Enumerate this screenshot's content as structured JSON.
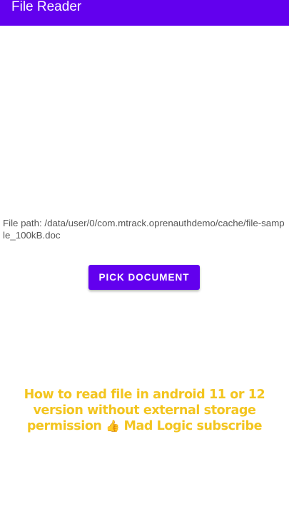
{
  "app_bar": {
    "title": "File Reader",
    "color": "#6200ee"
  },
  "main": {
    "file_path_text": "File path: /data/user/0/com.mtrack.oprenauthdemo/cache/file-sample_100kB.doc",
    "pick_button_label": "PICK DOCUMENT",
    "accent_color": "#6200ee"
  },
  "overlay_caption": {
    "line1": "How to read file in android 11 or 12",
    "line2": "version without external storage",
    "line3_before_icon": "permission",
    "icon": "thumbs-up-icon",
    "icon_glyph": "👍",
    "line3_after_icon": "Mad Logic subscribe",
    "color": "#f3c51f"
  }
}
